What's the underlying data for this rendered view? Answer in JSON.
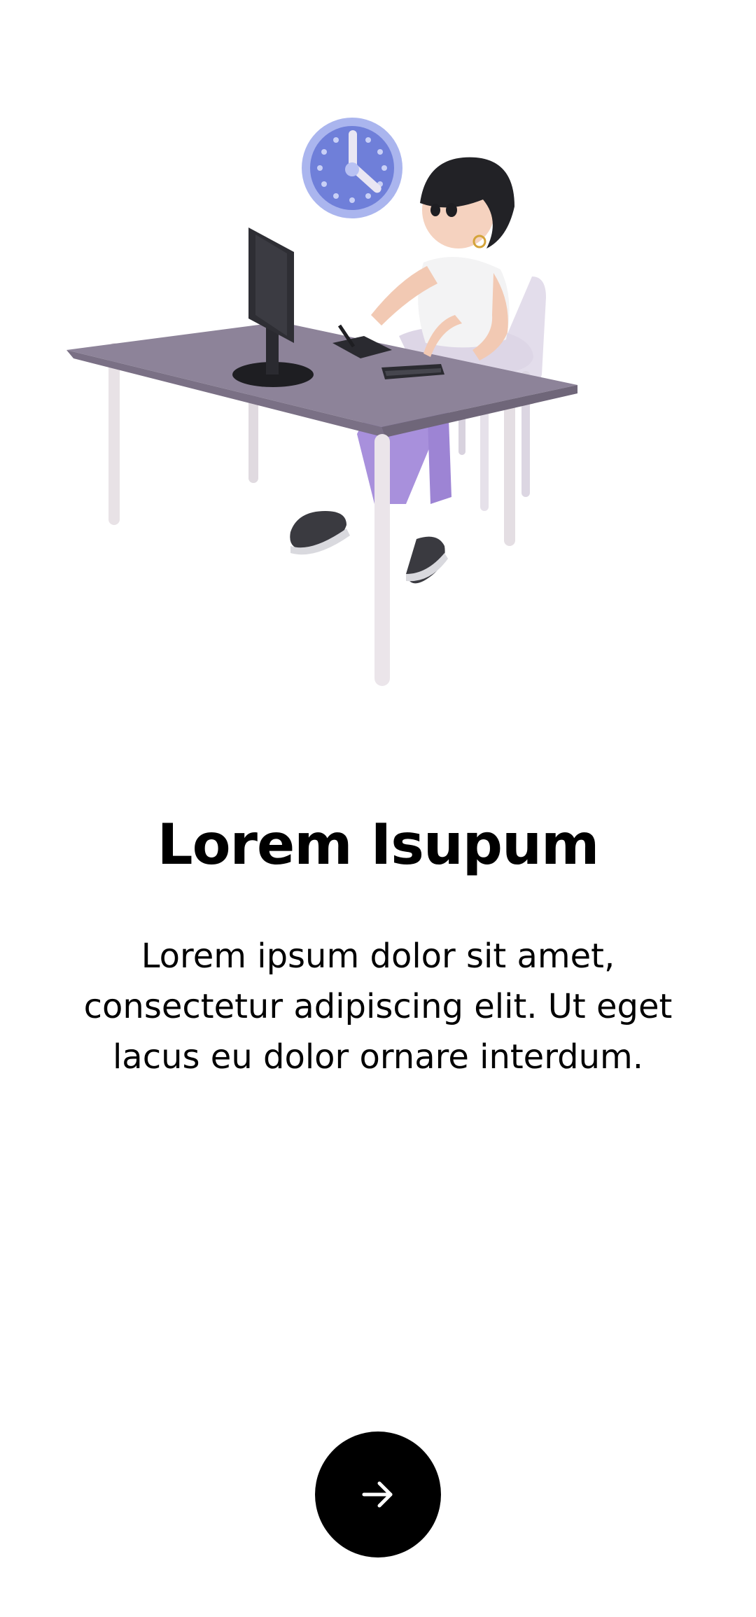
{
  "onboarding": {
    "title": "Lorem Isupum",
    "description": "Lorem ipsum dolor sit amet, consectetur adipiscing elit. Ut eget lacus eu dolor ornare interdum.",
    "next_icon": "arrow-right-icon"
  },
  "colors": {
    "background": "#ffffff",
    "button": "#000000",
    "button_icon": "#ffffff",
    "desk": "#8b8196",
    "clock": "#8e9be3",
    "pants": "#a58ad9"
  }
}
